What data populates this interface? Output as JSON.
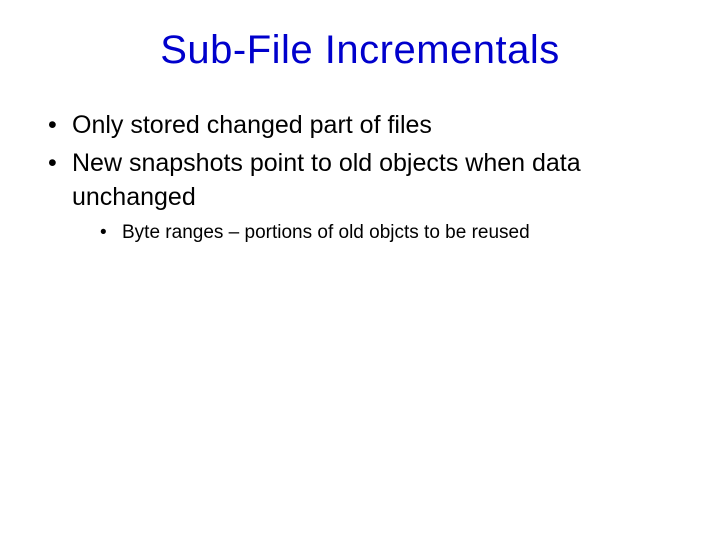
{
  "title": "Sub-File Incrementals",
  "bullets": [
    {
      "text": "Only stored changed part of files"
    },
    {
      "text": "New snapshots point to old objects when data unchanged"
    }
  ],
  "sub_bullets": [
    {
      "text": "Byte ranges – portions of old objcts to be reused"
    }
  ]
}
